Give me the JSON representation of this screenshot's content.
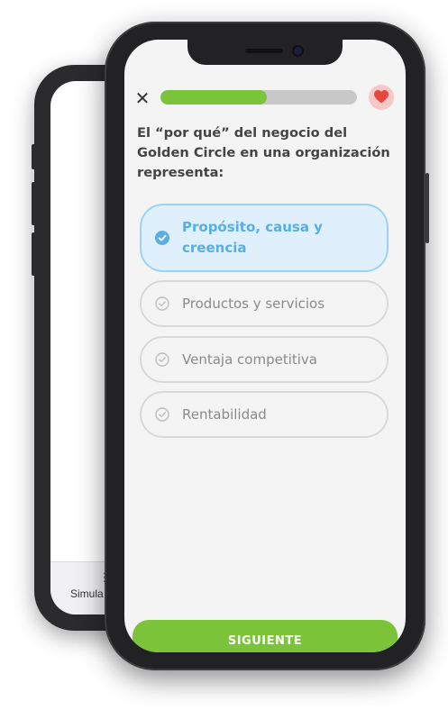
{
  "back_phone": {
    "tab_label": "Simula"
  },
  "quiz": {
    "progress_fraction": 0.54,
    "question": "El “por qué” del negocio del Golden Circle en una organización representa:",
    "options": [
      {
        "label": "Propósito, causa y creencia",
        "selected": true
      },
      {
        "label": "Productos y servicios",
        "selected": false
      },
      {
        "label": "Ventaja competitiva",
        "selected": false
      },
      {
        "label": "Rentabilidad",
        "selected": false
      }
    ],
    "next_button": "SIGUIENTE"
  },
  "colors": {
    "accent_green": "#7bc43a",
    "selected_blue": "#57afe2",
    "heart_red": "#e8473f"
  },
  "icons": {
    "close": "close-icon",
    "heart": "heart-icon",
    "check": "check-circle-icon",
    "list": "list-icon"
  }
}
